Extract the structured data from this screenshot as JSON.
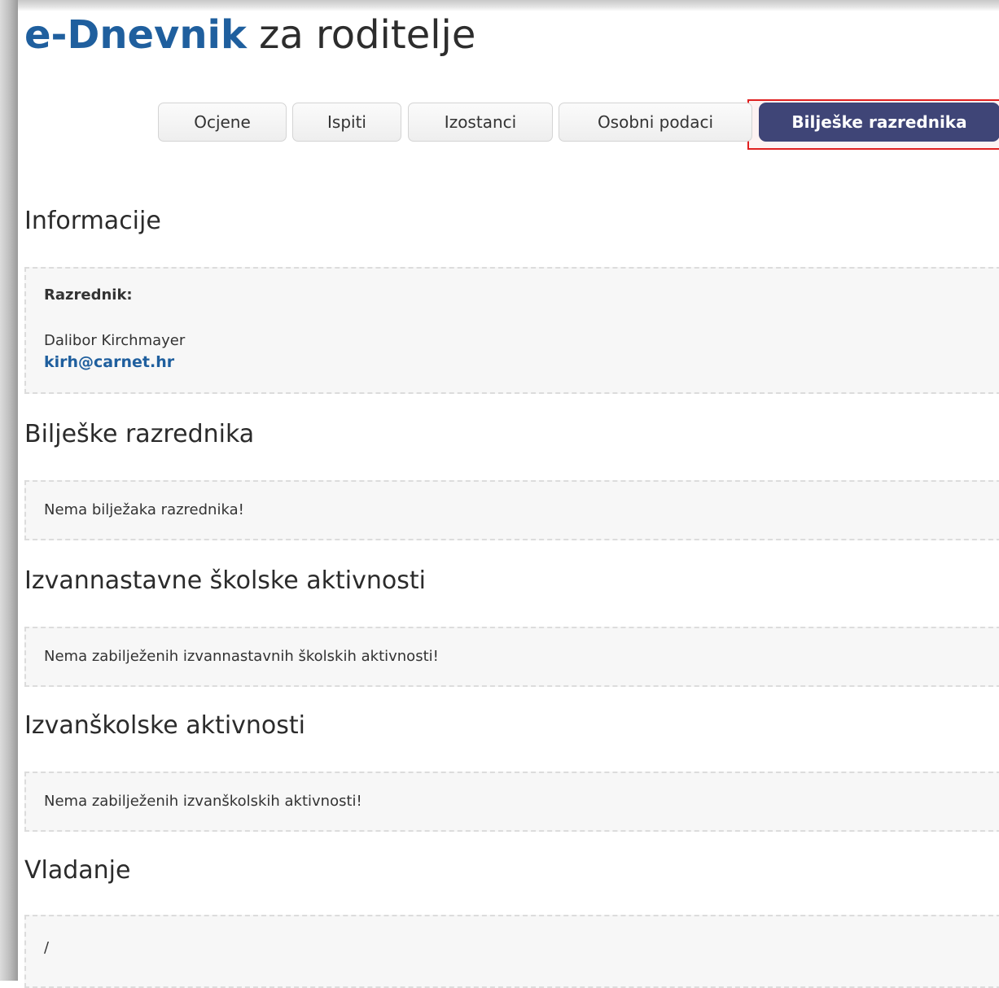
{
  "app": {
    "title_brand": "e-Dnevnik",
    "title_rest": " za roditelje"
  },
  "tabs": [
    {
      "label": "Ocjene",
      "active": false
    },
    {
      "label": "Ispiti",
      "active": false
    },
    {
      "label": "Izostanci",
      "active": false
    },
    {
      "label": "Osobni podaci",
      "active": false
    },
    {
      "label": "Bilješke razrednika",
      "active": true
    }
  ],
  "colors": {
    "brand": "#1f5f9e",
    "active_tab": "#3f4577",
    "highlight": "#e02020"
  },
  "sections": {
    "informacije": {
      "heading": "Informacije",
      "label": "Razrednik:",
      "name": "Dalibor Kirchmayer",
      "email": "kirh@carnet.hr"
    },
    "biljeske": {
      "heading": "Bilješke razrednika",
      "text": "Nema bilježaka razrednika!"
    },
    "izvannastavne": {
      "heading": "Izvannastavne školske aktivnosti",
      "text": "Nema zabilježenih izvannastavnih školskih aktivnosti!"
    },
    "izvanskolske": {
      "heading": "Izvanškolske aktivnosti",
      "text": "Nema zabilježenih izvanškolskih aktivnosti!"
    },
    "vladanje": {
      "heading": "Vladanje",
      "text": "/"
    }
  }
}
